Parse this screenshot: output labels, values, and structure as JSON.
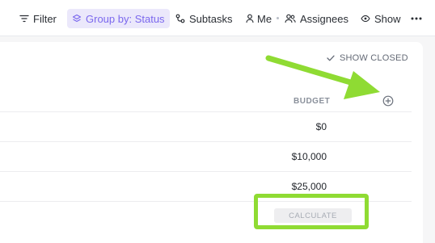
{
  "toolbar": {
    "filter_label": "Filter",
    "groupby_label": "Group by: Status",
    "subtasks_label": "Subtasks",
    "me_label": "Me",
    "assignees_label": "Assignees",
    "show_label": "Show",
    "more_icon": "more-horizontal-icon"
  },
  "list": {
    "show_closed_label": "SHOW CLOSED",
    "column_header": "BUDGET",
    "rows": [
      {
        "budget": "$0"
      },
      {
        "budget": "$10,000"
      },
      {
        "budget": "$25,000"
      }
    ],
    "calculate_label": "CALCULATE"
  },
  "annotations": {
    "highlight_color": "#8fdb33",
    "accent_color": "#7b68ee"
  }
}
